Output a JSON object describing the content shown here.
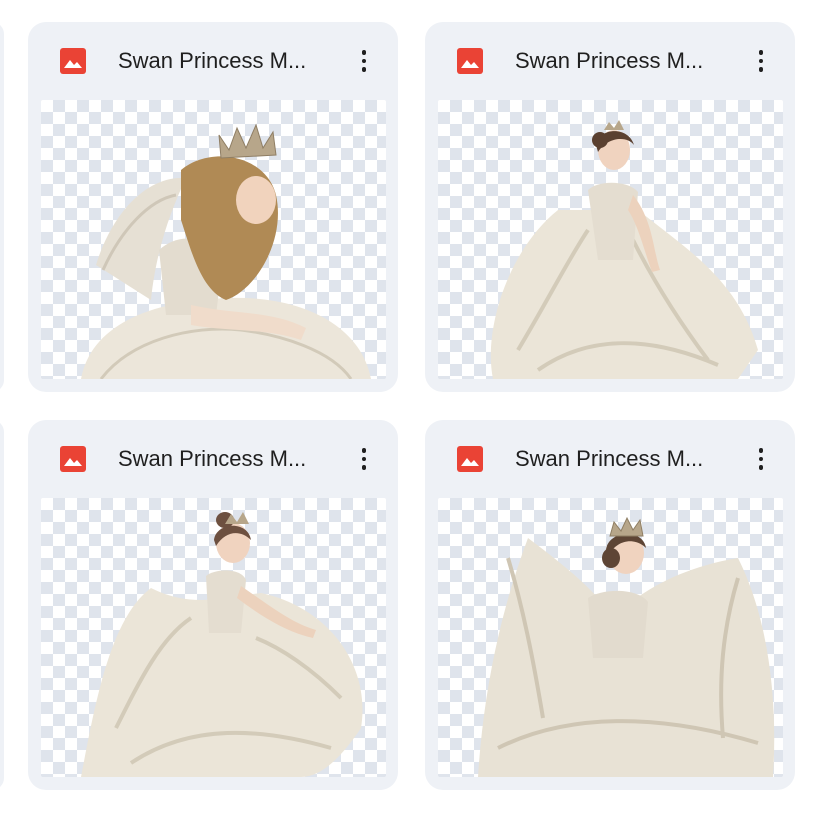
{
  "colors": {
    "card_background": "#eef1f6",
    "image_icon": "#ea4335",
    "title_text": "#1f1f1f",
    "checker": "#dfe4ec"
  },
  "files": [
    {
      "title": "Swan Princess M...",
      "type_icon": "image-file-icon",
      "thumbnail": "girl-with-feather-wings-crown-seated"
    },
    {
      "title": "Swan Princess M...",
      "type_icon": "image-file-icon",
      "thumbnail": "girl-in-feather-gown-standing"
    },
    {
      "title": "Swan Princess M...",
      "type_icon": "image-file-icon",
      "thumbnail": "girl-in-feather-gown-twirling"
    },
    {
      "title": "Swan Princess M...",
      "type_icon": "image-file-icon",
      "thumbnail": "girl-in-large-feather-gown-crown"
    }
  ]
}
